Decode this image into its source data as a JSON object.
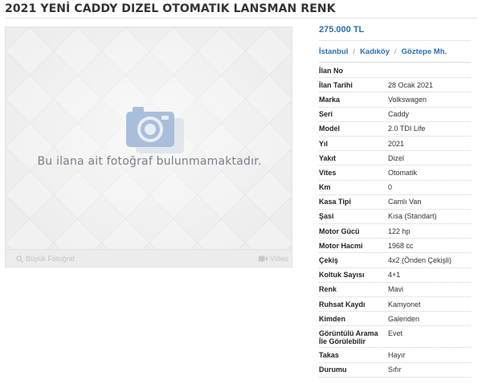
{
  "listing": {
    "title": "2021 YENİ CADDY DIZEL OTOMATIK LANSMAN RENK",
    "price": "275.000 TL",
    "location": [
      "İstanbul",
      "Kadıköy",
      "Göztepe Mh."
    ],
    "location_separator": "/"
  },
  "gallery": {
    "no_photo_text": "Bu ilana ait fotoğraf bulunmamaktadır.",
    "zoom_label": "Büyük Fotoğraf",
    "video_label": "Video"
  },
  "details": [
    {
      "label": "İlan No",
      "value": ""
    },
    {
      "label": "İlan Tarihi",
      "value": "28 Ocak 2021"
    },
    {
      "label": "Marka",
      "value": "Volkswagen"
    },
    {
      "label": "Seri",
      "value": "Caddy"
    },
    {
      "label": "Model",
      "value": "2.0 TDI Life"
    },
    {
      "label": "Yıl",
      "value": "2021"
    },
    {
      "label": "Yakıt",
      "value": "Dizel"
    },
    {
      "label": "Vites",
      "value": "Otomatik"
    },
    {
      "label": "Km",
      "value": "0"
    },
    {
      "label": "Kasa Tipi",
      "value": "Camlı Van"
    },
    {
      "label": "Şasi",
      "value": "Kısa (Standart)"
    },
    {
      "label": "Motor Gücü",
      "value": "122 hp"
    },
    {
      "label": "Motor Hacmi",
      "value": "1968 cc"
    },
    {
      "label": "Çekiş",
      "value": "4x2 (Önden Çekişli)"
    },
    {
      "label": "Koltuk Sayısı",
      "value": "4+1"
    },
    {
      "label": "Renk",
      "value": "Mavi"
    },
    {
      "label": "Ruhsat Kaydı",
      "value": "Kamyonet"
    },
    {
      "label": "Kimden",
      "value": "Galeriden"
    },
    {
      "label": "Görüntülü Arama İle Görülebilir",
      "value": "Evet"
    },
    {
      "label": "Takas",
      "value": "Hayır"
    },
    {
      "label": "Durumu",
      "value": "Sıfır"
    }
  ],
  "colors": {
    "link_blue": "#2a6fb0",
    "camera_blue": "#a9bedb"
  }
}
